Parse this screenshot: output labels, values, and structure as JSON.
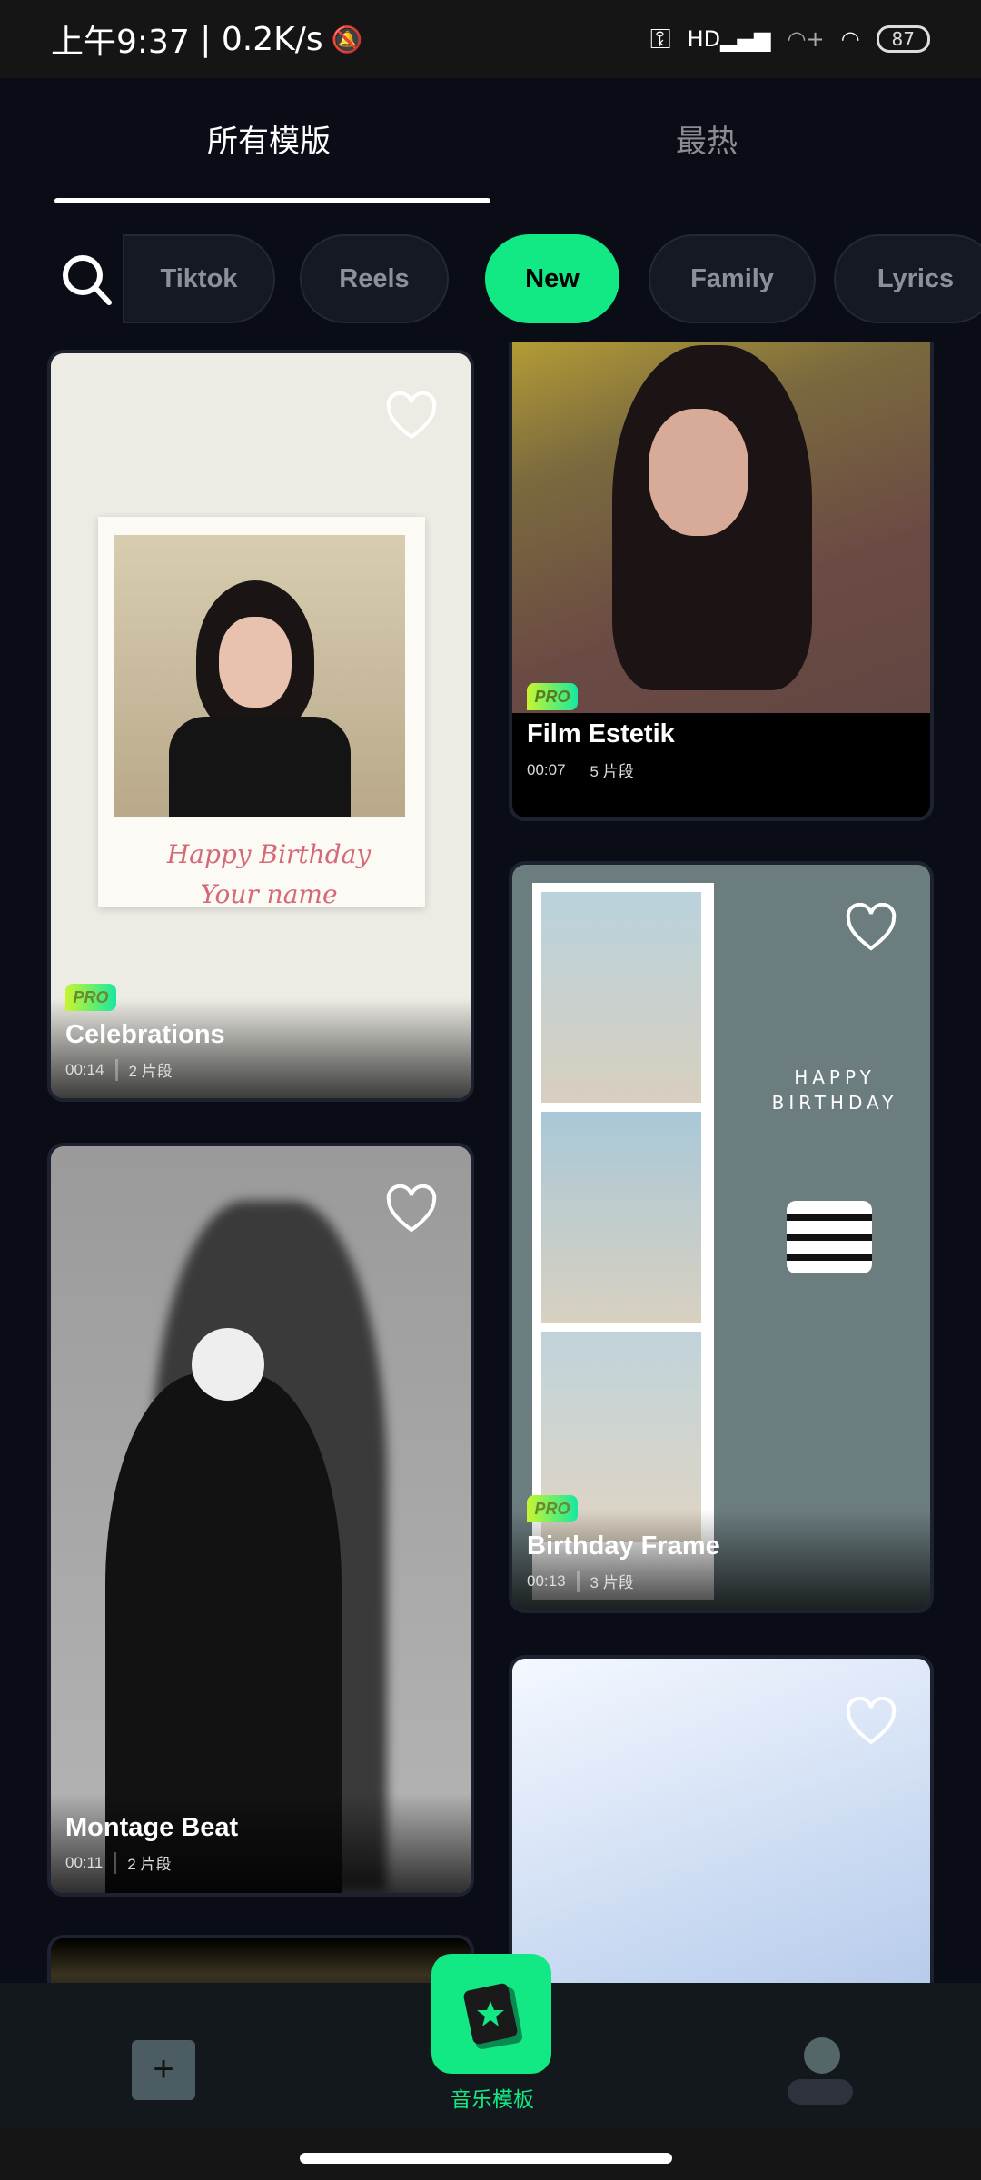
{
  "status_bar": {
    "time": "上午9:37",
    "speed": "0.2K/s",
    "battery": "87",
    "icons": [
      "mute-bell-icon",
      "key-icon",
      "hd-signal-icon",
      "wifi-plus-icon",
      "wifi-icon",
      "battery-icon"
    ]
  },
  "tabs": [
    {
      "label": "所有模版",
      "active": true
    },
    {
      "label": "最热",
      "active": false
    }
  ],
  "chips": [
    {
      "label": "Tiktok"
    },
    {
      "label": "Reels"
    },
    {
      "label": "New",
      "active": true
    },
    {
      "label": "Family"
    },
    {
      "label": "Lyrics"
    }
  ],
  "accent": "#12e884",
  "cards": [
    {
      "title": "Celebrations",
      "duration": "00:14",
      "segments": "2 片段",
      "pro": true,
      "pro_label": "PRO",
      "thumb_text": [
        "Happy Birthday",
        "Your name"
      ]
    },
    {
      "title": "Film Estetik",
      "duration": "00:07",
      "segments": "5 片段",
      "pro": true,
      "pro_label": "PRO"
    },
    {
      "title": "Montage Beat",
      "duration": "00:11",
      "segments": "2 片段",
      "pro": false
    },
    {
      "title": "Birthday Frame",
      "duration": "00:13",
      "segments": "3 片段",
      "pro": true,
      "pro_label": "PRO",
      "thumb_text": [
        "HAPPY",
        "BIRTHDAY"
      ]
    }
  ],
  "bottom_nav": {
    "center_label": "音乐模板",
    "items": [
      "plus-icon",
      "music-template-icon",
      "profile-icon"
    ]
  }
}
